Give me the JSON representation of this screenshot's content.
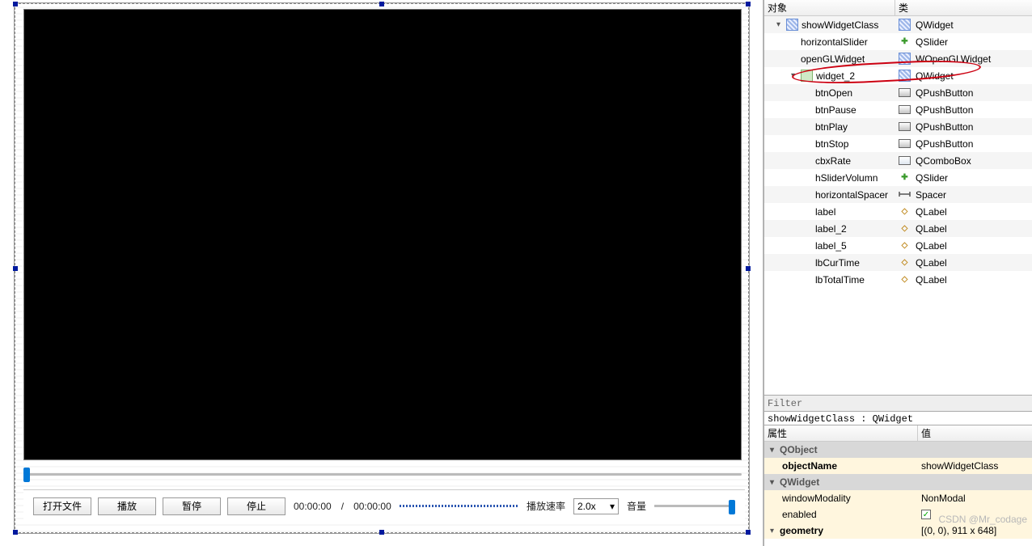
{
  "designer": {
    "buttons": {
      "open": "打开文件",
      "play": "播放",
      "pause": "暂停",
      "stop": "停止"
    },
    "curTime": "00:00:00",
    "sep": "/",
    "totalTime": "00:00:00",
    "rateLabel": "播放速率",
    "rateValue": "2.0x",
    "volumeLabel": "音量"
  },
  "objectHeader": {
    "col1": "对象",
    "col2": "类"
  },
  "tree": [
    {
      "depth": 0,
      "exp": "v",
      "name": "showWidgetClass",
      "icon": "widget",
      "cls": "QWidget",
      "clsIcon": "widget",
      "alt": true
    },
    {
      "depth": 1,
      "exp": "",
      "name": "horizontalSlider",
      "icon": "",
      "cls": "QSlider",
      "clsIcon": "slider",
      "alt": false
    },
    {
      "depth": 1,
      "exp": "",
      "name": "openGLWidget",
      "icon": "",
      "cls": "WOpenGLWidget",
      "clsIcon": "widget",
      "alt": true,
      "circled": true
    },
    {
      "depth": 1,
      "exp": "v",
      "name": "widget_2",
      "icon": "vbox",
      "cls": "QWidget",
      "clsIcon": "widget",
      "alt": false
    },
    {
      "depth": 2,
      "exp": "",
      "name": "btnOpen",
      "icon": "",
      "cls": "QPushButton",
      "clsIcon": "push",
      "alt": true
    },
    {
      "depth": 2,
      "exp": "",
      "name": "btnPause",
      "icon": "",
      "cls": "QPushButton",
      "clsIcon": "push",
      "alt": false
    },
    {
      "depth": 2,
      "exp": "",
      "name": "btnPlay",
      "icon": "",
      "cls": "QPushButton",
      "clsIcon": "push",
      "alt": true
    },
    {
      "depth": 2,
      "exp": "",
      "name": "btnStop",
      "icon": "",
      "cls": "QPushButton",
      "clsIcon": "push",
      "alt": false
    },
    {
      "depth": 2,
      "exp": "",
      "name": "cbxRate",
      "icon": "",
      "cls": "QComboBox",
      "clsIcon": "combo",
      "alt": true
    },
    {
      "depth": 2,
      "exp": "",
      "name": "hSliderVolumn",
      "icon": "",
      "cls": "QSlider",
      "clsIcon": "slider",
      "alt": false
    },
    {
      "depth": 2,
      "exp": "",
      "name": "horizontalSpacer",
      "icon": "",
      "cls": "Spacer",
      "clsIcon": "spacer",
      "alt": true
    },
    {
      "depth": 2,
      "exp": "",
      "name": "label",
      "icon": "",
      "cls": "QLabel",
      "clsIcon": "label",
      "alt": false
    },
    {
      "depth": 2,
      "exp": "",
      "name": "label_2",
      "icon": "",
      "cls": "QLabel",
      "clsIcon": "label",
      "alt": true
    },
    {
      "depth": 2,
      "exp": "",
      "name": "label_5",
      "icon": "",
      "cls": "QLabel",
      "clsIcon": "label",
      "alt": false
    },
    {
      "depth": 2,
      "exp": "",
      "name": "lbCurTime",
      "icon": "",
      "cls": "QLabel",
      "clsIcon": "label",
      "alt": true
    },
    {
      "depth": 2,
      "exp": "",
      "name": "lbTotalTime",
      "icon": "",
      "cls": "QLabel",
      "clsIcon": "label",
      "alt": false
    }
  ],
  "filterPlaceholder": "Filter",
  "objectPath": "showWidgetClass : QWidget",
  "propHeader": {
    "col1": "属性",
    "col2": "值"
  },
  "props": [
    {
      "type": "cat",
      "exp": "v",
      "label": "QObject"
    },
    {
      "type": "prop",
      "name": "objectName",
      "value": "showWidgetClass",
      "bold": true
    },
    {
      "type": "cat",
      "exp": "v",
      "label": "QWidget"
    },
    {
      "type": "prop",
      "name": "windowModality",
      "value": "NonModal"
    },
    {
      "type": "prop",
      "name": "enabled",
      "value": "check"
    },
    {
      "type": "cat2",
      "exp": "v",
      "label": "geometry",
      "value": "[(0, 0), 911 x 648]"
    }
  ],
  "watermark": "CSDN @Mr_codage"
}
